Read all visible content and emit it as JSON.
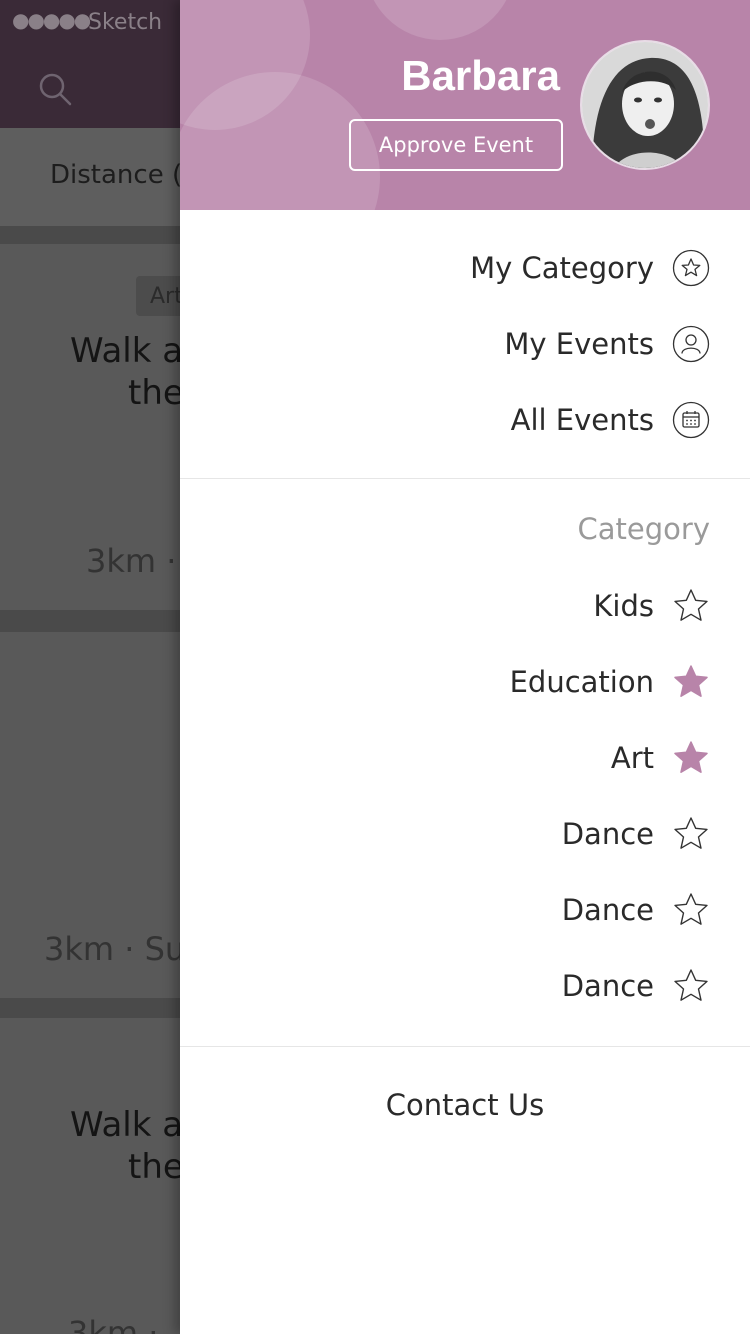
{
  "status_bar": {
    "signal": "●●●●●",
    "carrier": "Sketch"
  },
  "background": {
    "filter_label": "Distance (",
    "cards": [
      {
        "tag": "Art",
        "title_line1": "Walk a",
        "title_line2": "the",
        "meta": "3km · S"
      },
      {
        "meta": "3km · Sun"
      },
      {
        "title_line1": "Walk a",
        "title_line2": "the",
        "meta": "3km ·"
      }
    ]
  },
  "drawer": {
    "user_name": "Barbara",
    "approve_button": "Approve Event",
    "menu": [
      {
        "label": "My Category",
        "icon": "star-circle-icon"
      },
      {
        "label": "My Events",
        "icon": "user-circle-icon"
      },
      {
        "label": "All Events",
        "icon": "calendar-circle-icon"
      }
    ],
    "category_heading": "Category",
    "categories": [
      {
        "label": "Kids",
        "selected": false
      },
      {
        "label": "Education",
        "selected": true
      },
      {
        "label": "Art",
        "selected": true
      },
      {
        "label": "Dance",
        "selected": false
      },
      {
        "label": "Dance",
        "selected": false
      },
      {
        "label": "Dance",
        "selected": false
      }
    ],
    "contact": "Contact Us"
  },
  "colors": {
    "accent": "#b884a9",
    "background_dim": "#4a4a4a",
    "text": "#2a2a2a",
    "muted": "#9a9a9a"
  }
}
